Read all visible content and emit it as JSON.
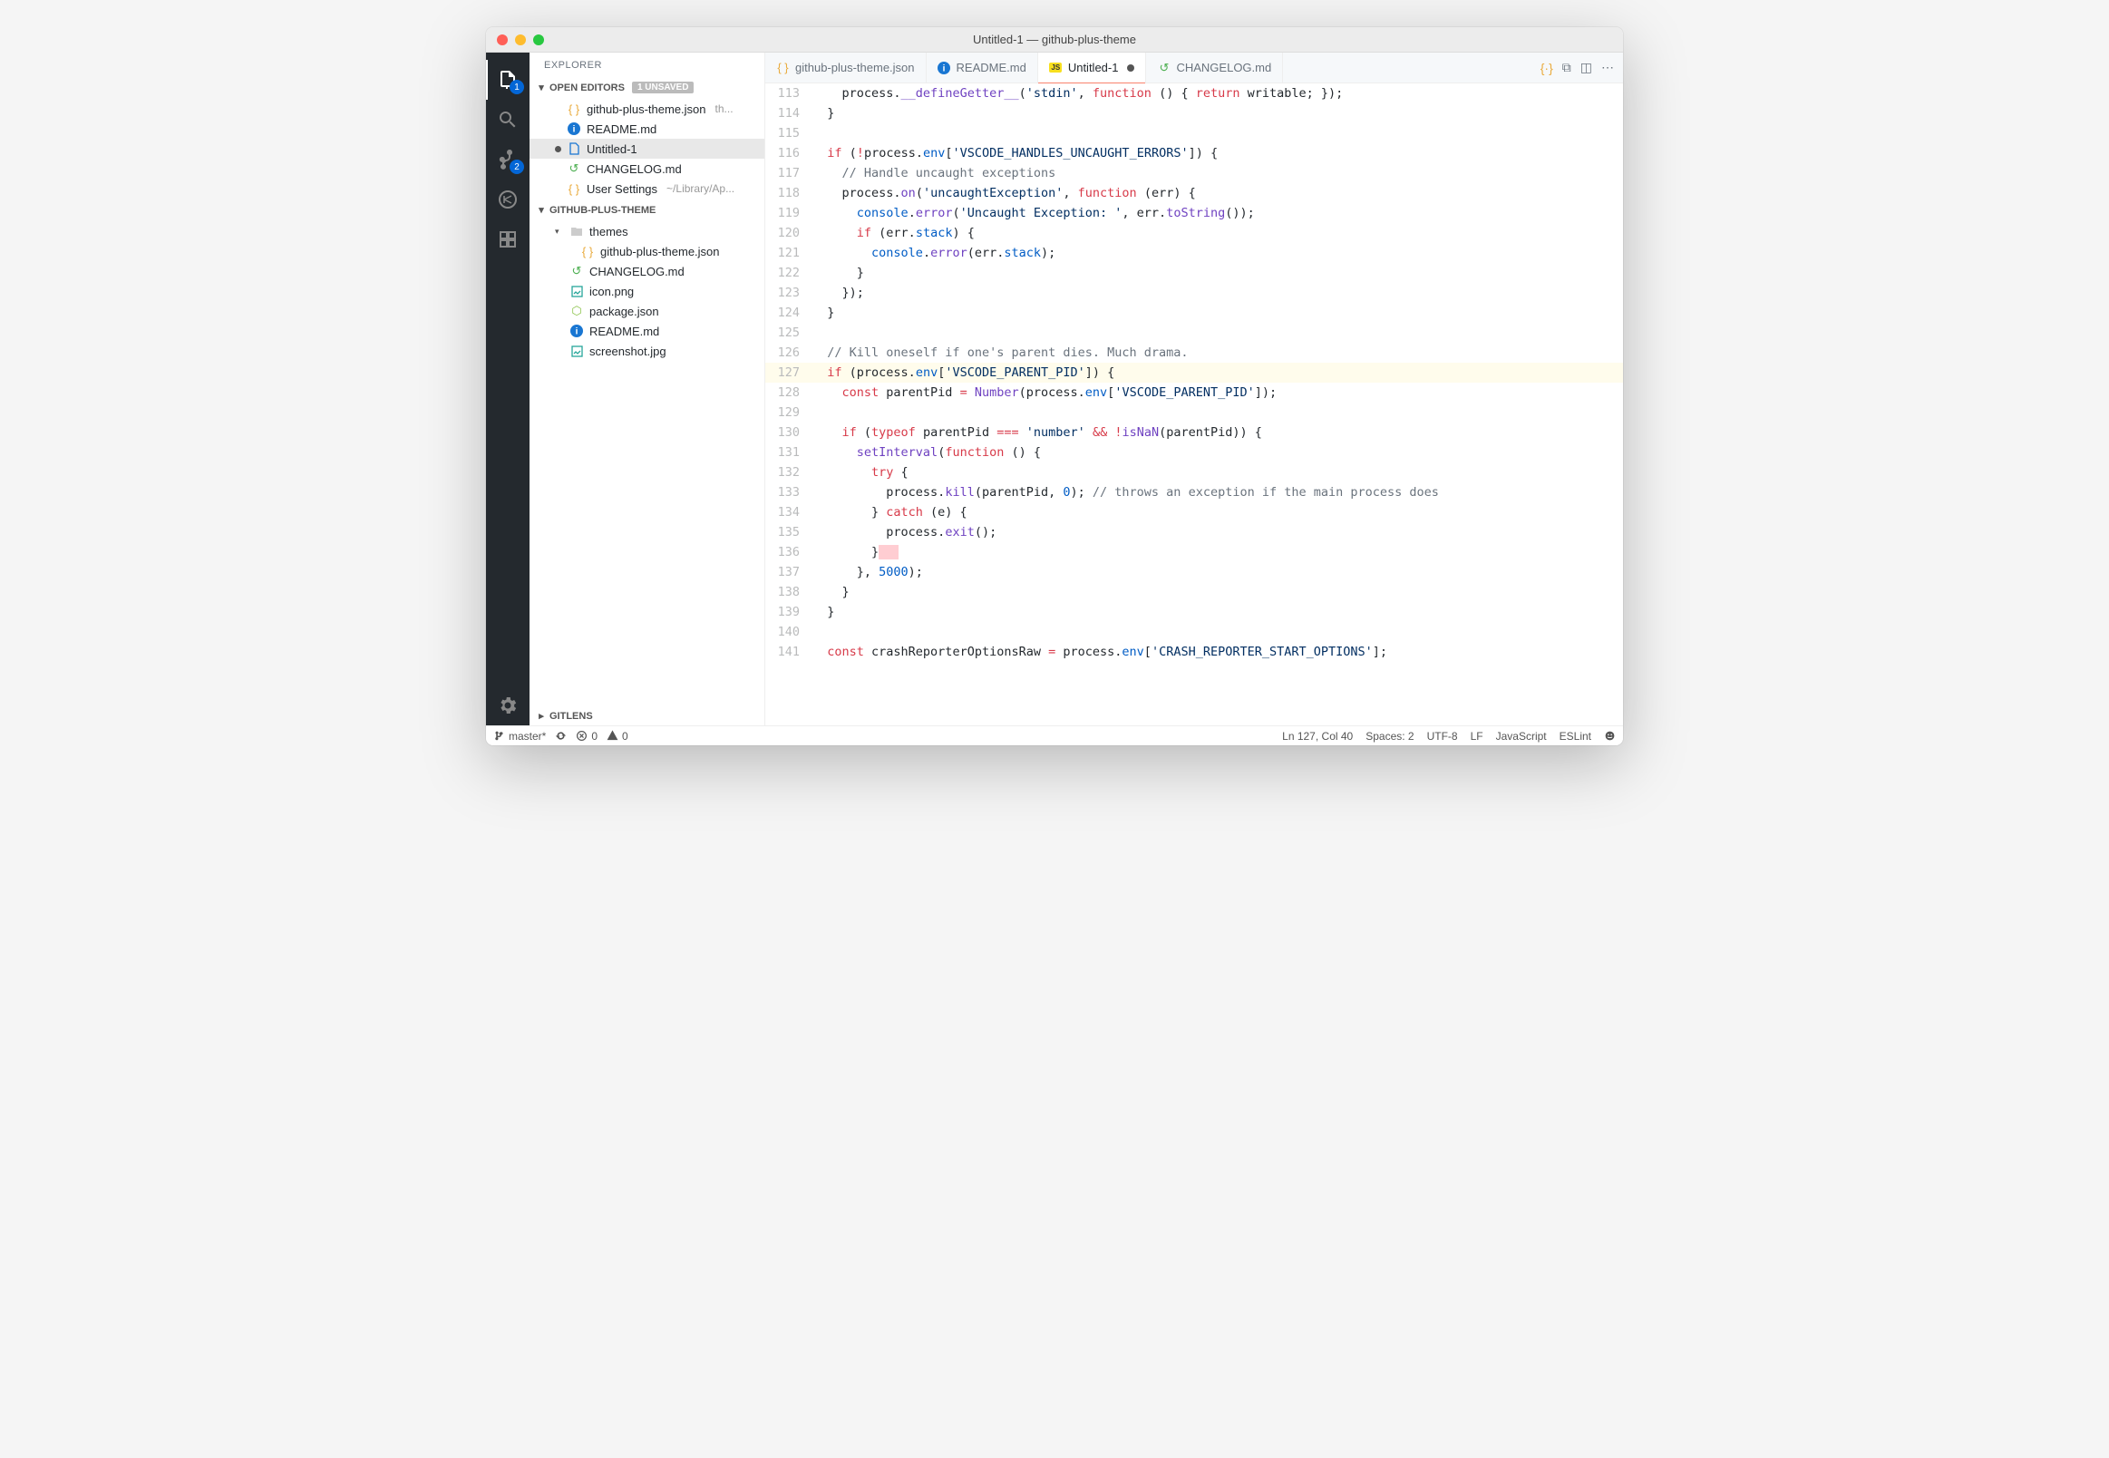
{
  "window": {
    "title": "Untitled-1 — github-plus-theme"
  },
  "activitybar": {
    "explorer_badge": "1",
    "scm_badge": "2"
  },
  "sidebar": {
    "title": "EXPLORER",
    "open_editors": {
      "label": "OPEN EDITORS",
      "unsaved_badge": "1 UNSAVED",
      "items": [
        {
          "icon": "json",
          "label": "github-plus-theme.json",
          "hint": "th..."
        },
        {
          "icon": "info",
          "label": "README.md"
        },
        {
          "icon": "file",
          "label": "Untitled-1",
          "modified": true
        },
        {
          "icon": "history",
          "label": "CHANGELOG.md"
        },
        {
          "icon": "json",
          "label": "User Settings",
          "hint": "~/Library/Ap..."
        }
      ]
    },
    "workspace": {
      "label": "GITHUB-PLUS-THEME",
      "tree": [
        {
          "type": "folder",
          "label": "themes",
          "expanded": true,
          "children": [
            {
              "icon": "json",
              "label": "github-plus-theme.json"
            }
          ]
        },
        {
          "icon": "history",
          "label": "CHANGELOG.md"
        },
        {
          "icon": "img",
          "label": "icon.png"
        },
        {
          "icon": "npm",
          "label": "package.json"
        },
        {
          "icon": "info",
          "label": "README.md"
        },
        {
          "icon": "img",
          "label": "screenshot.jpg"
        }
      ]
    },
    "gitlens": {
      "label": "GITLENS"
    }
  },
  "tabs": [
    {
      "icon": "json",
      "label": "github-plus-theme.json"
    },
    {
      "icon": "info",
      "label": "README.md"
    },
    {
      "icon": "js",
      "label": "Untitled-1",
      "active": true,
      "modified": true
    },
    {
      "icon": "history",
      "label": "CHANGELOG.md"
    }
  ],
  "editor": {
    "highlighted_line": 127,
    "cursor_mark_line": 136,
    "lines": [
      {
        "n": 113,
        "html": "    process.<span class='tok-fn'>__defineGetter__</span>(<span class='tok-str'>'stdin'</span>, <span class='tok-kw'>function</span> () { <span class='tok-kw'>return</span> writable; });"
      },
      {
        "n": 114,
        "html": "  }"
      },
      {
        "n": 115,
        "html": ""
      },
      {
        "n": 116,
        "html": "  <span class='tok-kw'>if</span> (<span class='tok-kw'>!</span>process.<span class='tok-prop'>env</span>[<span class='tok-str'>'VSCODE_HANDLES_UNCAUGHT_ERRORS'</span>]) {"
      },
      {
        "n": 117,
        "html": "    <span class='tok-cmt'>// Handle uncaught exceptions</span>"
      },
      {
        "n": 118,
        "html": "    process.<span class='tok-fn'>on</span>(<span class='tok-str'>'uncaughtException'</span>, <span class='tok-kw'>function</span> (<span class='tok-ident'>err</span>) {"
      },
      {
        "n": 119,
        "html": "      <span class='tok-prop'>console</span>.<span class='tok-fn'>error</span>(<span class='tok-str'>'Uncaught Exception: '</span>, err.<span class='tok-fn'>toString</span>());"
      },
      {
        "n": 120,
        "html": "      <span class='tok-kw'>if</span> (err.<span class='tok-prop'>stack</span>) {"
      },
      {
        "n": 121,
        "html": "        <span class='tok-prop'>console</span>.<span class='tok-fn'>error</span>(err.<span class='tok-prop'>stack</span>);"
      },
      {
        "n": 122,
        "html": "      }"
      },
      {
        "n": 123,
        "html": "    });"
      },
      {
        "n": 124,
        "html": "  }"
      },
      {
        "n": 125,
        "html": ""
      },
      {
        "n": 126,
        "html": "  <span class='tok-cmt'>// Kill oneself if one's parent dies. Much drama.</span>"
      },
      {
        "n": 127,
        "html": "  <span class='tok-kw'>if</span> (process.<span class='tok-prop'>env</span>[<span class='tok-str'>'VSCODE_PARENT_PID'</span>]) {"
      },
      {
        "n": 128,
        "html": "    <span class='tok-kw'>const</span> parentPid <span class='tok-kw'>=</span> <span class='tok-fn'>Number</span>(process.<span class='tok-prop'>env</span>[<span class='tok-str'>'VSCODE_PARENT_PID'</span>]);"
      },
      {
        "n": 129,
        "html": ""
      },
      {
        "n": 130,
        "html": "    <span class='tok-kw'>if</span> (<span class='tok-kw'>typeof</span> parentPid <span class='tok-kw'>===</span> <span class='tok-str'>'number'</span> <span class='tok-kw'>&amp;&amp;</span> <span class='tok-kw'>!</span><span class='tok-fn'>isNaN</span>(parentPid)) {"
      },
      {
        "n": 131,
        "html": "      <span class='tok-fn'>setInterval</span>(<span class='tok-kw'>function</span> () {"
      },
      {
        "n": 132,
        "html": "        <span class='tok-kw'>try</span> {"
      },
      {
        "n": 133,
        "html": "          process.<span class='tok-fn'>kill</span>(parentPid, <span class='tok-num'>0</span>); <span class='tok-cmt'>// throws an exception if the main process does</span>"
      },
      {
        "n": 134,
        "html": "        } <span class='tok-kw'>catch</span> (e) {"
      },
      {
        "n": 135,
        "html": "          process.<span class='tok-fn'>exit</span>();"
      },
      {
        "n": 136,
        "html": "        }<span class='sel-mark'></span>"
      },
      {
        "n": 137,
        "html": "      }, <span class='tok-num'>5000</span>);"
      },
      {
        "n": 138,
        "html": "    }"
      },
      {
        "n": 139,
        "html": "  }"
      },
      {
        "n": 140,
        "html": ""
      },
      {
        "n": 141,
        "html": "  <span class='tok-kw'>const</span> crashReporterOptionsRaw <span class='tok-kw'>=</span> process.<span class='tok-prop'>env</span>[<span class='tok-str'>'CRASH_REPORTER_START_OPTIONS'</span>];"
      }
    ]
  },
  "statusbar": {
    "branch": "master*",
    "errors": "0",
    "warnings": "0",
    "position": "Ln 127, Col 40",
    "spaces": "Spaces: 2",
    "encoding": "UTF-8",
    "eol": "LF",
    "language": "JavaScript",
    "eslint": "ESLint"
  }
}
